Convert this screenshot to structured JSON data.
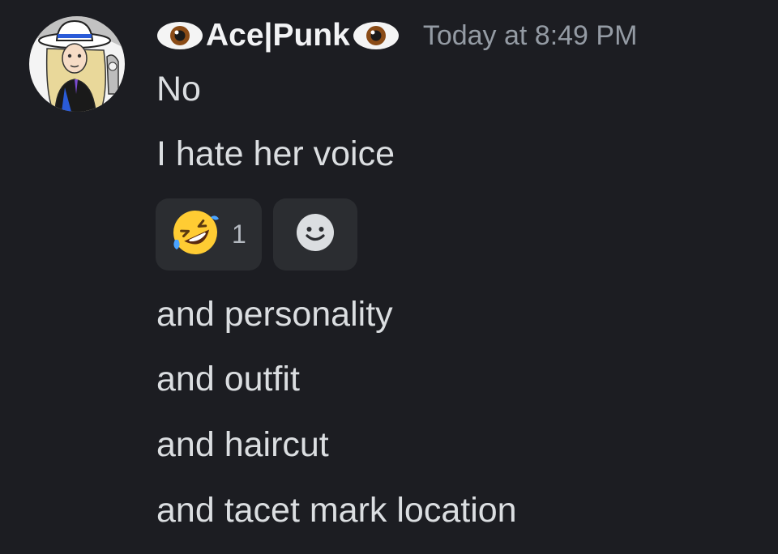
{
  "message": {
    "author": "Ace|Punk",
    "author_prefix_icon": "eye-icon",
    "author_suffix_icon": "eye-icon",
    "timestamp": "Today at 8:49 PM",
    "avatar_icon": "user-avatar",
    "lines": [
      "No",
      "I hate her voice"
    ],
    "reactions": [
      {
        "emoji_icon": "rolling-on-floor-laughing-emoji",
        "count": "1"
      }
    ],
    "add_reaction_icon": "add-reaction-smiley-icon",
    "followups": [
      "and personality",
      "and outfit",
      "and haircut",
      "and tacet mark location"
    ]
  },
  "colors": {
    "background": "#1c1d22",
    "text": "#dbdee1",
    "username": "#f2f3f5",
    "timestamp": "#949ba4",
    "reaction_bg": "#2b2d31"
  }
}
